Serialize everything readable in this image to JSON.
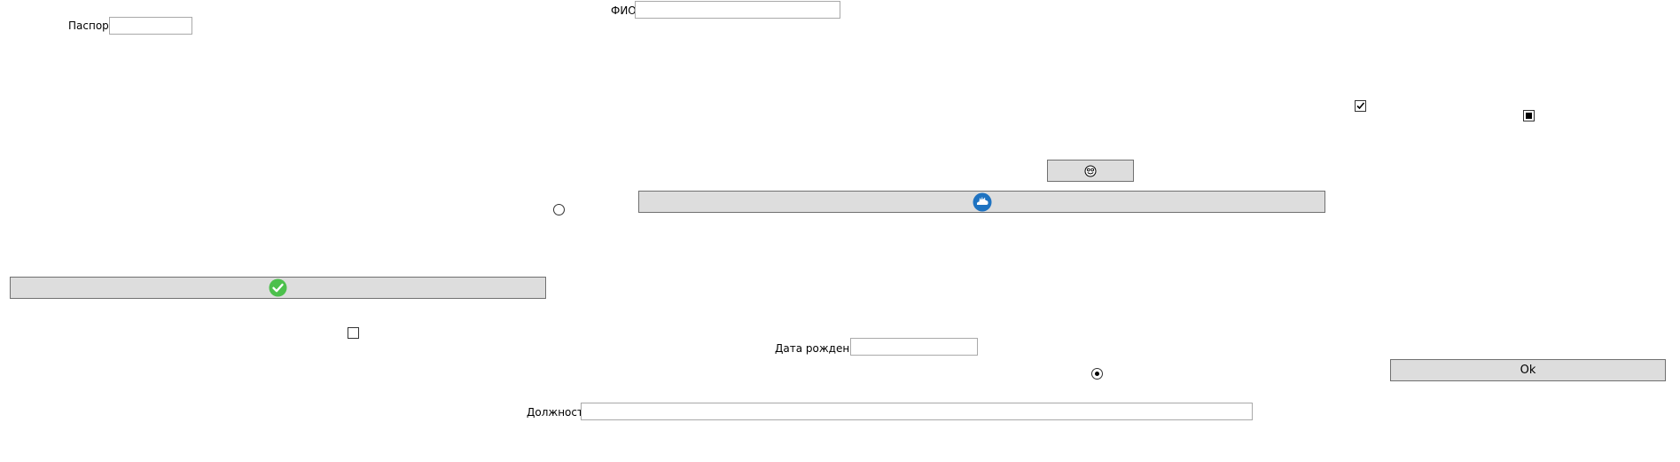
{
  "form": {
    "fio_label": "ФИО",
    "fio_value": "",
    "passport_label": "Паспорт",
    "passport_value": "",
    "birthdate_label": "Дата рождения",
    "birthdate_value": "",
    "position_label": "Должность",
    "position_value": ""
  },
  "buttons": {
    "ok_label": "Ok",
    "emoji_icon": "face-icon",
    "cloud_icon": "cloud-icon",
    "confirm_icon": "check-circle-icon"
  },
  "controls": {
    "checkbox_top_checked": true,
    "checkbox_top_right_state": "indeterminate",
    "checkbox_lower_checked": false,
    "radio_left_selected": false,
    "radio_lower_selected": true
  },
  "colors": {
    "button_bg": "#dddddd",
    "cloud_blue": "#1f73c1",
    "check_green": "#4cc04c"
  }
}
